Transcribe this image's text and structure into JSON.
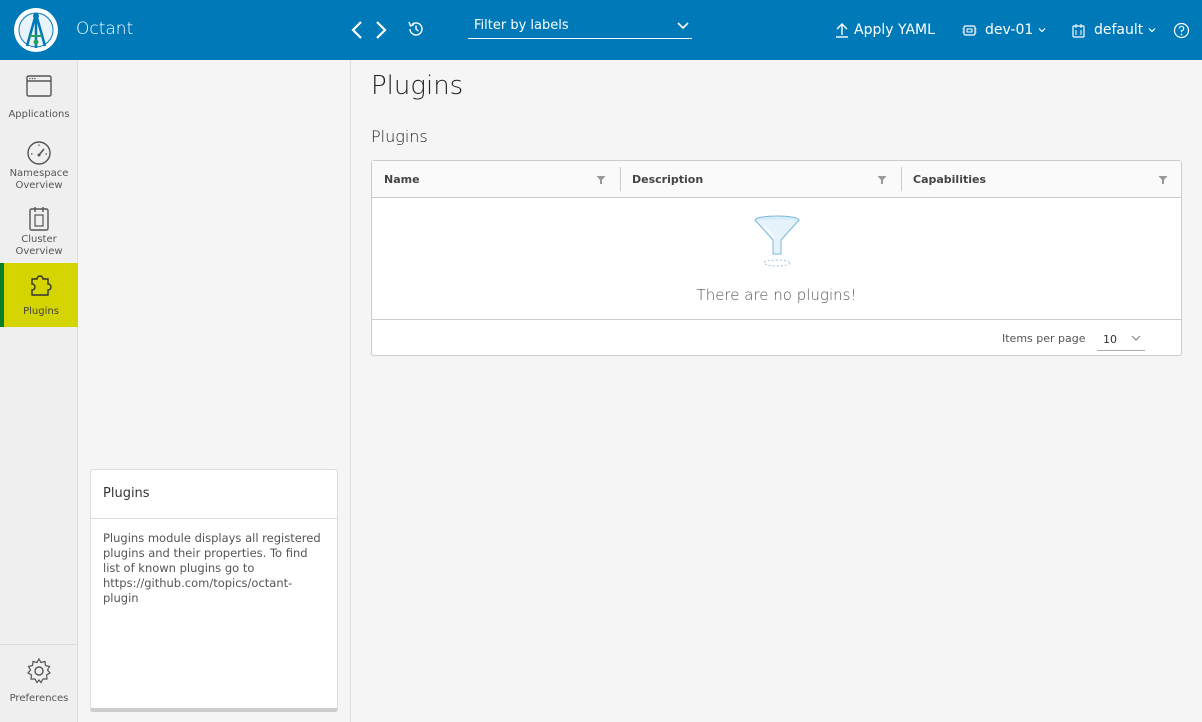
{
  "header": {
    "app_title": "Octant",
    "filter_placeholder": "Filter by labels",
    "apply_yaml_label": "Apply YAML",
    "context": "dev-01",
    "namespace": "default",
    "brand_color": "#0079b8"
  },
  "rail": {
    "items": [
      {
        "label_line1": "Applications",
        "label_line2": ""
      },
      {
        "label_line1": "Namespace",
        "label_line2": "Overview"
      },
      {
        "label_line1": "Cluster",
        "label_line2": "Overview"
      },
      {
        "label_line1": "Plugins",
        "label_line2": ""
      }
    ],
    "active_index": 3,
    "preferences_label": "Preferences"
  },
  "help_card": {
    "title": "Plugins",
    "body": "Plugins module displays all registered plugins and their properties. To find list of known plugins go to https://github.com/topics/octant-plugin"
  },
  "main": {
    "page_title": "Plugins",
    "section_title": "Plugins",
    "columns": [
      "Name",
      "Description",
      "Capabilities"
    ],
    "empty_message": "There are no plugins!",
    "items_per_page_label": "Items per page",
    "items_per_page_value": "10"
  }
}
